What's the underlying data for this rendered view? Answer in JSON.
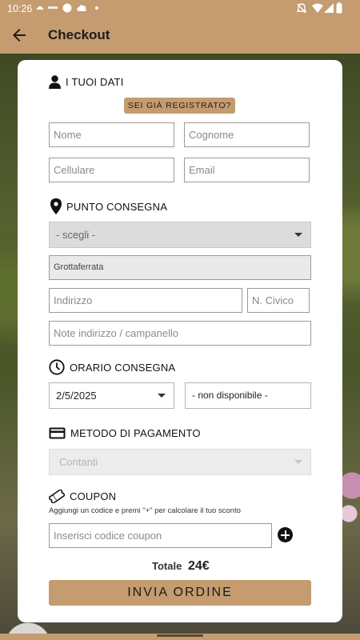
{
  "status_bar": {
    "time": "10:26"
  },
  "app_bar": {
    "title": "Checkout"
  },
  "sections": {
    "dati": {
      "title": "I TUOI DATI",
      "register_button": "SEI GIÀ REGISTRATO?"
    },
    "consegna": {
      "title": "PUNTO CONSEGNA"
    },
    "orario": {
      "title": "ORARIO CONSEGNA"
    },
    "pagamento": {
      "title": "METODO DI PAGAMENTO"
    },
    "coupon": {
      "title": "COUPON",
      "help": "Aggiungi un codice e premi \"+\" per calcolare il tuo sconto"
    }
  },
  "fields": {
    "nome": {
      "placeholder": "Nome"
    },
    "cognome": {
      "placeholder": "Cognome"
    },
    "cellulare": {
      "placeholder": "Cellulare"
    },
    "email": {
      "placeholder": "Email"
    },
    "punto": {
      "value": "- scegli -"
    },
    "citta": {
      "value": "Grottaferrata"
    },
    "indirizzo": {
      "placeholder": "Indirizzo"
    },
    "civico": {
      "placeholder": "N. Civico"
    },
    "note": {
      "placeholder": "Note indirizzo / campanello"
    },
    "data": {
      "value": "2/5/2025"
    },
    "ora": {
      "value": "- non disponibile -"
    },
    "pagamento": {
      "value": "Contanti"
    },
    "coupon": {
      "placeholder": "Inserisci codice coupon"
    }
  },
  "total": {
    "label": "Totale",
    "amount": "24€"
  },
  "submit_label": "INVIA ORDINE",
  "icons": {
    "back": "arrow-left-icon",
    "user": "user-icon",
    "pin": "location-pin-icon",
    "clock": "clock-icon",
    "card": "credit-card-icon",
    "ticket": "ticket-icon",
    "plus": "plus-circle-icon"
  },
  "colors": {
    "brand": "#c49c70",
    "text": "#1d1d1d"
  }
}
